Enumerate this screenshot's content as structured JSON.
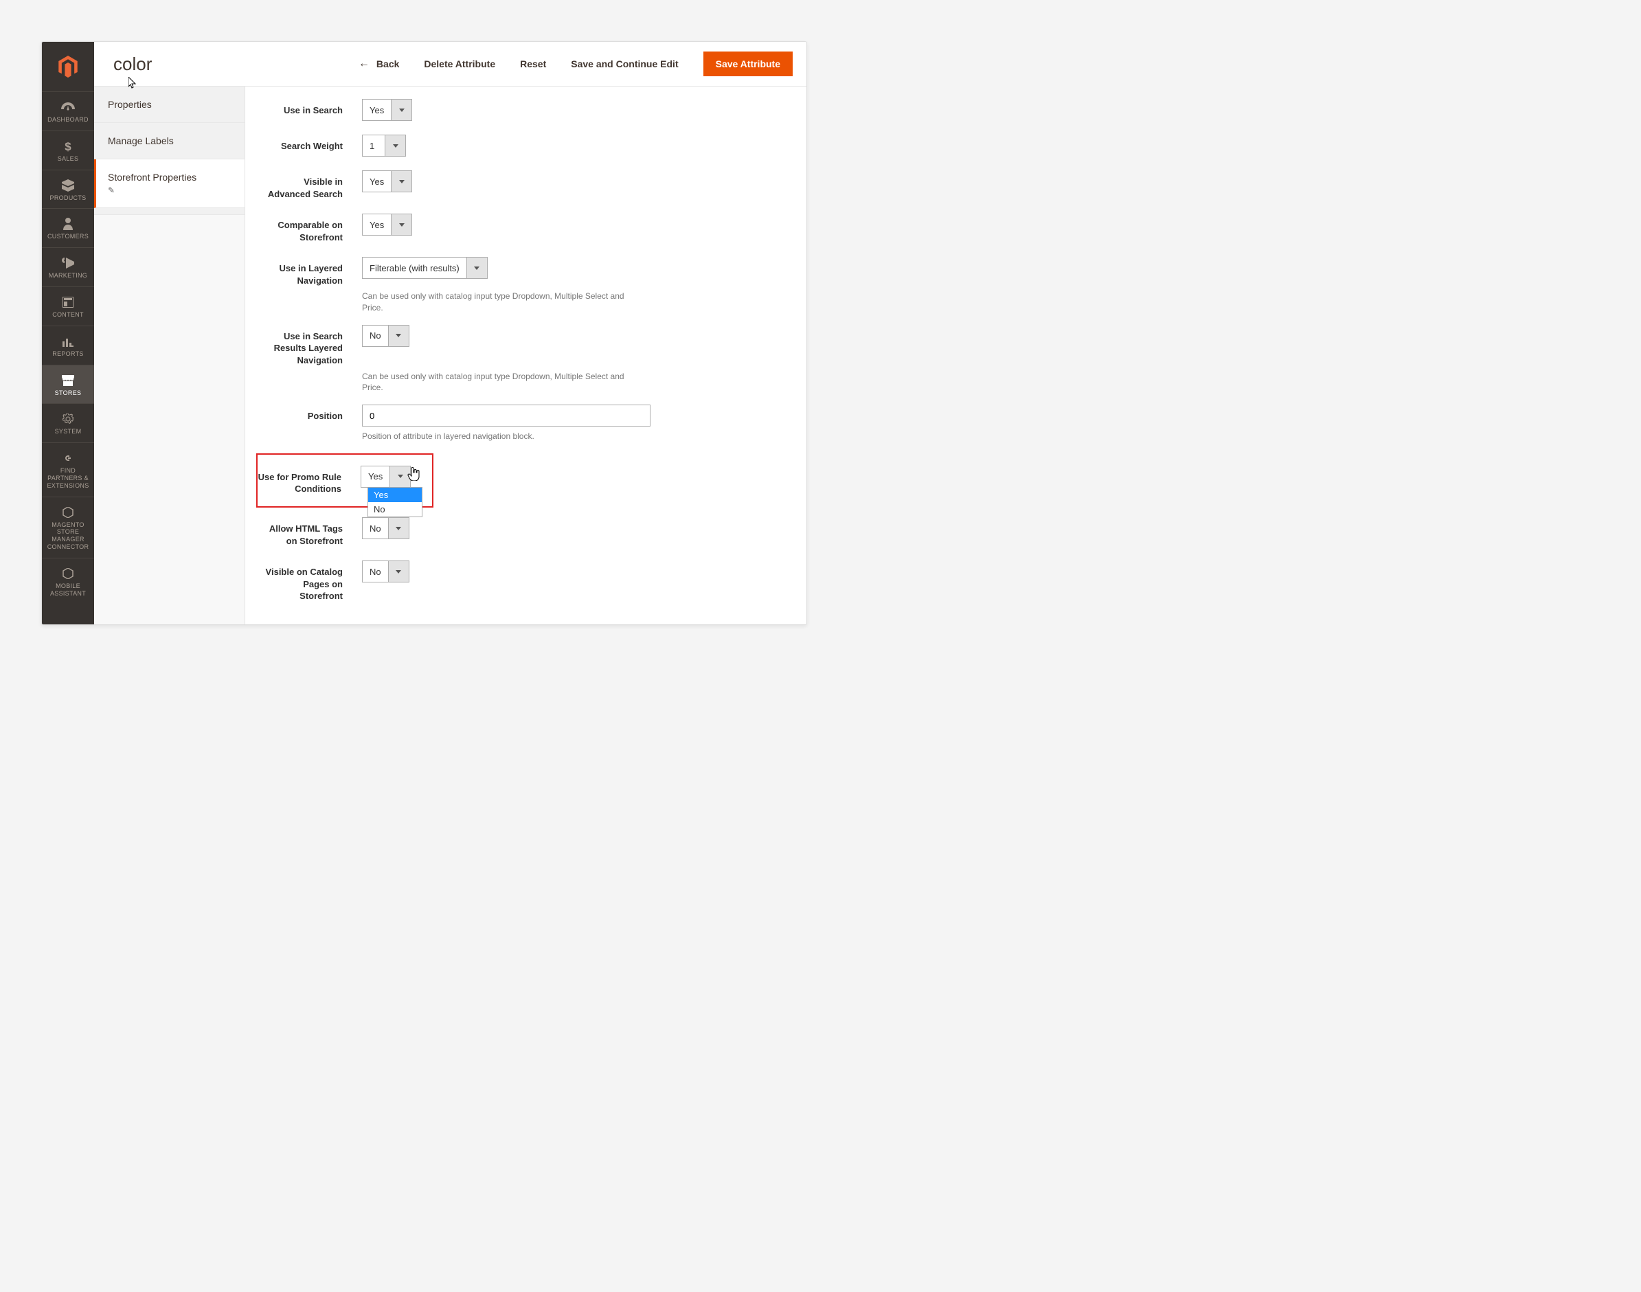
{
  "page_title": "color",
  "header_actions": {
    "back": "Back",
    "delete": "Delete Attribute",
    "reset": "Reset",
    "save_continue": "Save and Continue Edit",
    "save": "Save Attribute"
  },
  "sidebar_nav": [
    {
      "id": "dashboard",
      "label": "DASHBOARD"
    },
    {
      "id": "sales",
      "label": "SALES"
    },
    {
      "id": "products",
      "label": "PRODUCTS"
    },
    {
      "id": "customers",
      "label": "CUSTOMERS"
    },
    {
      "id": "marketing",
      "label": "MARKETING"
    },
    {
      "id": "content",
      "label": "CONTENT"
    },
    {
      "id": "reports",
      "label": "REPORTS"
    },
    {
      "id": "stores",
      "label": "STORES",
      "active": true
    },
    {
      "id": "system",
      "label": "SYSTEM"
    },
    {
      "id": "find_partners",
      "label": "FIND PARTNERS & EXTENSIONS"
    },
    {
      "id": "store_manager",
      "label": "MAGENTO STORE MANAGER CONNECTOR"
    },
    {
      "id": "mobile",
      "label": "MOBILE ASSISTANT"
    }
  ],
  "tabs": {
    "properties": "Properties",
    "manage_labels": "Manage Labels",
    "storefront_properties": "Storefront Properties"
  },
  "fields": {
    "use_in_search": {
      "label": "Use in Search",
      "value": "Yes"
    },
    "search_weight": {
      "label": "Search Weight",
      "value": "1"
    },
    "visible_adv_search": {
      "label": "Visible in Advanced Search",
      "value": "Yes"
    },
    "comparable": {
      "label": "Comparable on Storefront",
      "value": "Yes"
    },
    "layered_nav": {
      "label": "Use in Layered Navigation",
      "value": "Filterable (with results)",
      "note": "Can be used only with catalog input type Dropdown, Multiple Select and Price."
    },
    "search_results_layered": {
      "label": "Use in Search Results Layered Navigation",
      "value": "No",
      "note": "Can be used only with catalog input type Dropdown, Multiple Select and Price."
    },
    "position": {
      "label": "Position",
      "value": "0",
      "note": "Position of attribute in layered navigation block."
    },
    "promo_rule": {
      "label": "Use for Promo Rule Conditions",
      "value": "Yes",
      "options": [
        "Yes",
        "No"
      ],
      "selected": "Yes"
    },
    "allow_html": {
      "label": "Allow HTML Tags on Storefront",
      "value": "No"
    },
    "visible_catalog": {
      "label": "Visible on Catalog Pages on Storefront",
      "value": "No"
    }
  }
}
